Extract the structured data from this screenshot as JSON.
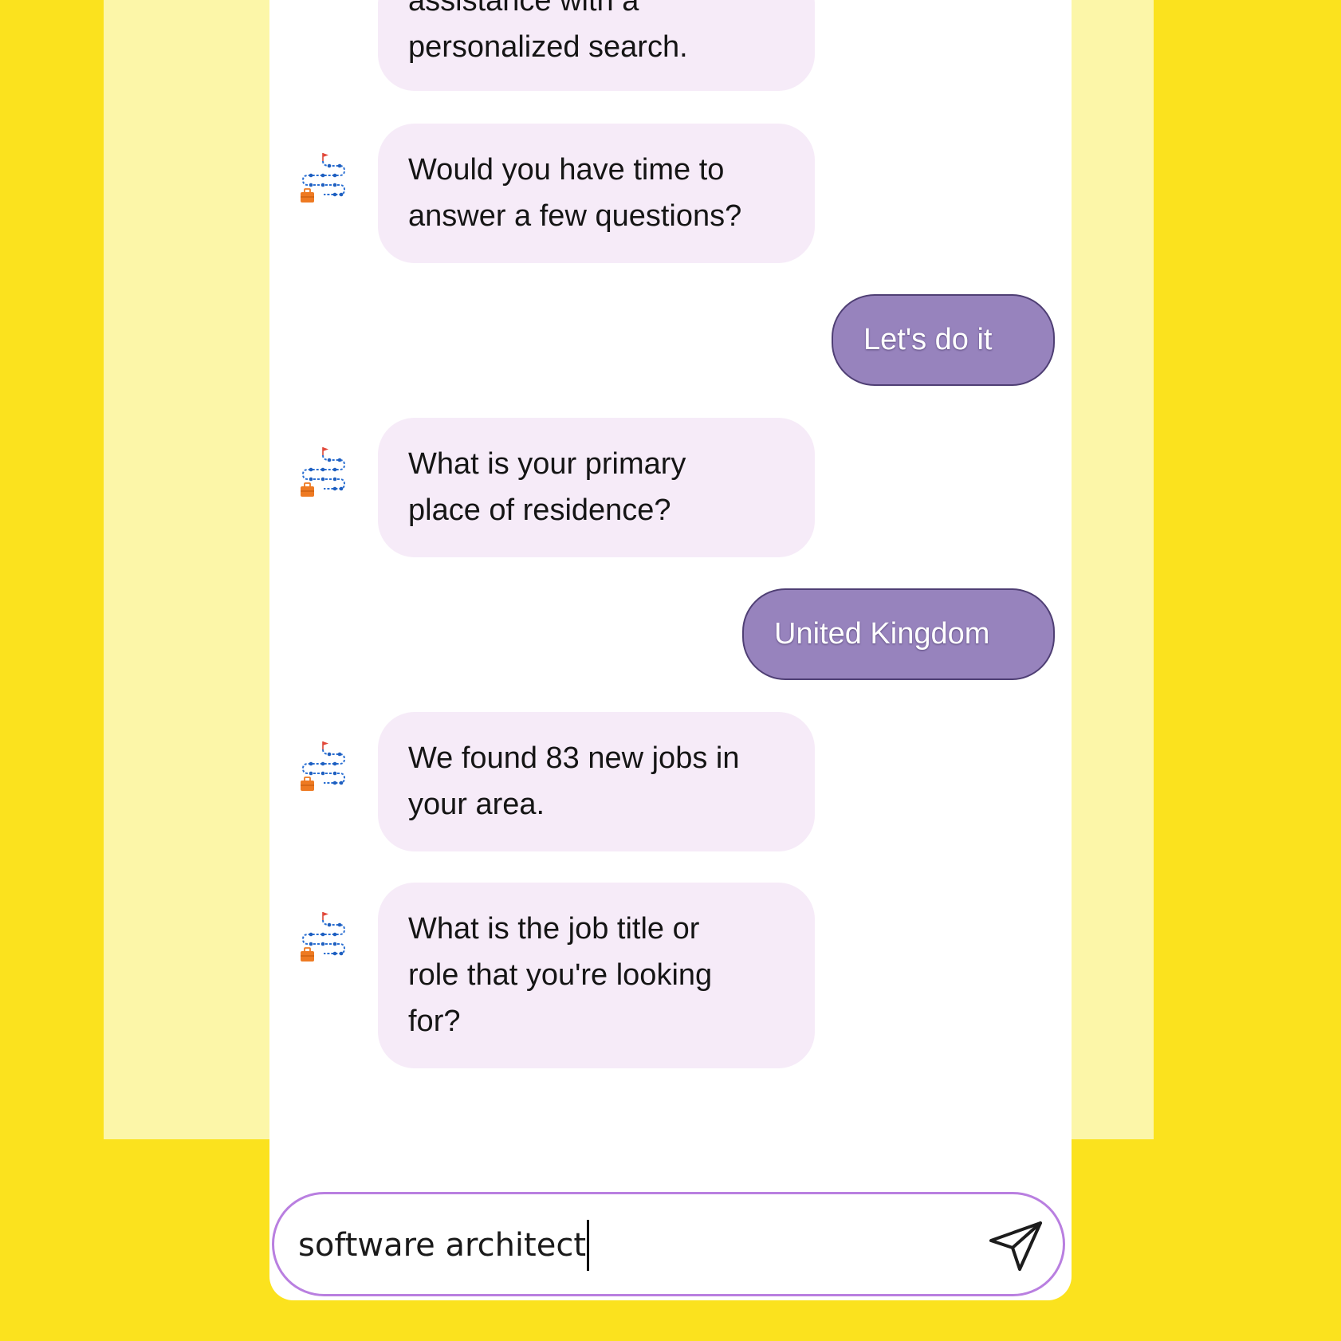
{
  "colors": {
    "page_background": "#fbe21e",
    "backdrop_panel": "#fcf6a8",
    "bot_bubble": "#f6ebf8",
    "user_bubble": "#9783bd",
    "input_border": "#b97fe0"
  },
  "bot_avatar_icon": "job-path-icon",
  "messages": [
    {
      "sender": "bot",
      "lines": [
        "assistance with a",
        "personalized search."
      ],
      "show_avatar": false
    },
    {
      "sender": "bot",
      "lines": [
        "Would you have time to",
        "answer a few questions?"
      ],
      "show_avatar": true
    },
    {
      "sender": "user",
      "text": "Let's do it"
    },
    {
      "sender": "bot",
      "lines": [
        "What is your primary",
        "place of residence?"
      ],
      "show_avatar": true
    },
    {
      "sender": "user",
      "text": "United Kingdom"
    },
    {
      "sender": "bot",
      "lines": [
        "We found 83 new jobs in",
        "your area."
      ],
      "show_avatar": true
    },
    {
      "sender": "bot",
      "lines": [
        "What is the job title or",
        "role that you're looking",
        "for?"
      ],
      "show_avatar": true
    }
  ],
  "composer": {
    "value": "software architect",
    "send_icon": "send-icon"
  }
}
